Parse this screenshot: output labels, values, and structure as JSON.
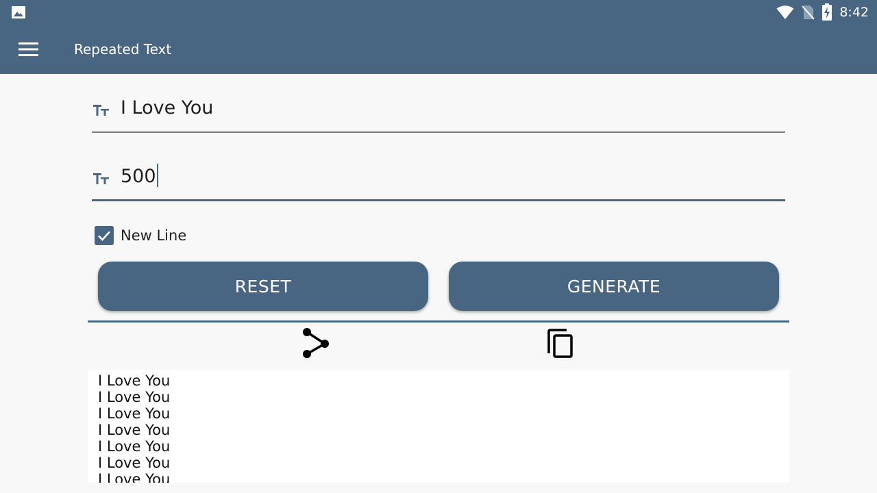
{
  "status_bar": {
    "time": "8:42",
    "icons": [
      "image-notification-icon",
      "wifi-icon",
      "no-sim-icon",
      "battery-charging-icon"
    ]
  },
  "app_bar": {
    "title": "Repeated Text",
    "menu_icon": "hamburger-menu-icon"
  },
  "form": {
    "text_field": {
      "value": "I Love You",
      "icon": "text-size-icon"
    },
    "count_field": {
      "value": "500",
      "icon": "text-size-icon"
    },
    "new_line": {
      "label": "New Line",
      "checked": true
    }
  },
  "buttons": {
    "reset_label": "RESET",
    "generate_label": "GENERATE"
  },
  "actions": {
    "share_icon": "share-icon",
    "copy_icon": "copy-icon"
  },
  "output": {
    "lines": [
      "I Love You",
      "I Love You",
      "I Love You",
      "I Love You",
      "I Love You",
      "I Love You",
      "I Love You"
    ]
  },
  "colors": {
    "primary": "#486581",
    "background": "#f8f8f8",
    "output_background": "#ffffff"
  }
}
